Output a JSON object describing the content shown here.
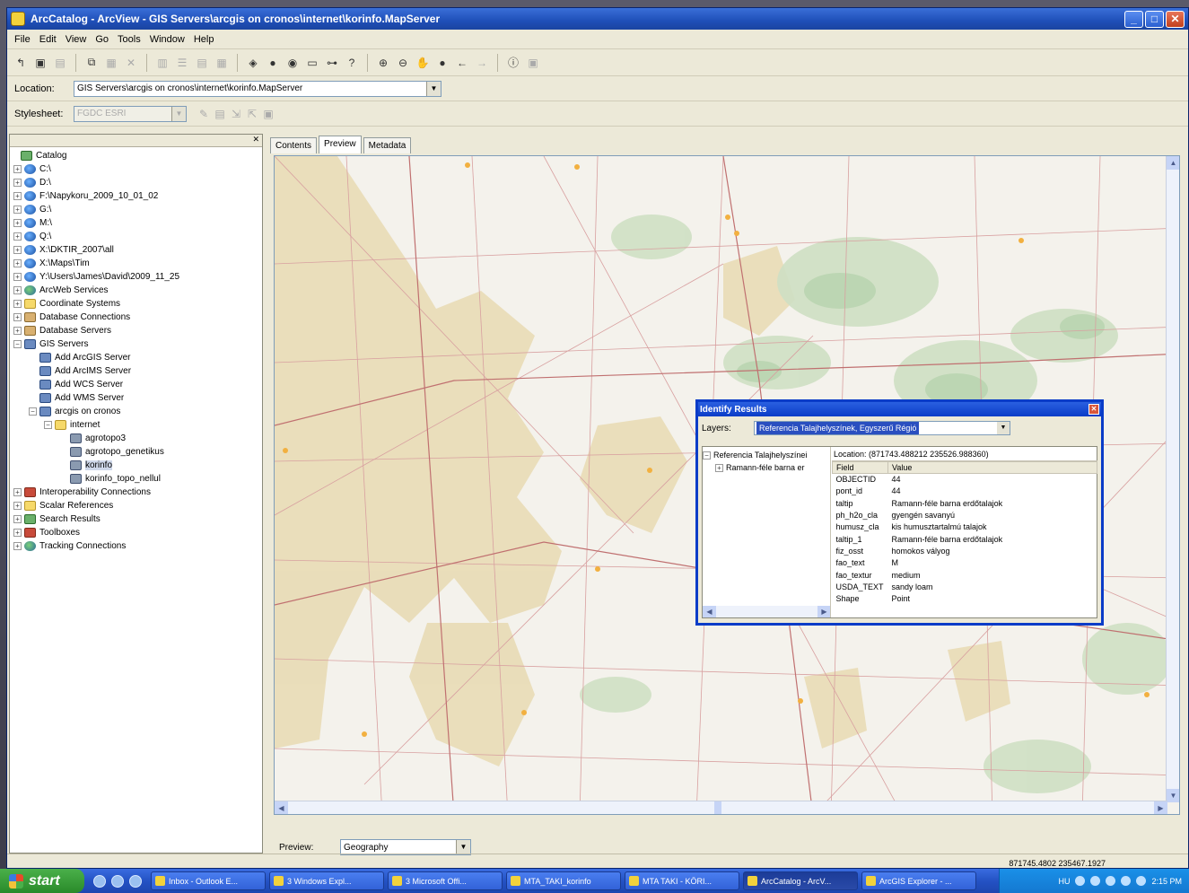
{
  "window": {
    "title": "ArcCatalog - ArcView - GIS Servers\\arcgis on cronos\\internet\\korinfo.MapServer",
    "min": "_",
    "max": "□",
    "close": "✕"
  },
  "menu": [
    "File",
    "Edit",
    "View",
    "Go",
    "Tools",
    "Window",
    "Help"
  ],
  "location": {
    "label": "Location:",
    "value": "GIS Servers\\arcgis on cronos\\internet\\korinfo.MapServer"
  },
  "stylesheet": {
    "label": "Stylesheet:",
    "value": "FGDC ESRI"
  },
  "catalog": {
    "root": "Catalog",
    "items": [
      {
        "label": "C:\\",
        "level": 1,
        "icon": "drive"
      },
      {
        "label": "D:\\",
        "level": 1,
        "icon": "drive"
      },
      {
        "label": "F:\\Napykoru_2009_10_01_02",
        "level": 1,
        "icon": "drive"
      },
      {
        "label": "G:\\",
        "level": 1,
        "icon": "drive"
      },
      {
        "label": "M:\\",
        "level": 1,
        "icon": "drive"
      },
      {
        "label": "Q:\\",
        "level": 1,
        "icon": "drive"
      },
      {
        "label": "X:\\DKTIR_2007\\all",
        "level": 1,
        "icon": "drive"
      },
      {
        "label": "X:\\Maps\\Tim",
        "level": 1,
        "icon": "drive"
      },
      {
        "label": "Y:\\Users\\James\\David\\2009_11_25",
        "level": 1,
        "icon": "drive"
      },
      {
        "label": "ArcWeb Services",
        "level": 1,
        "icon": "globe"
      },
      {
        "label": "Coordinate Systems",
        "level": 1,
        "icon": "folder"
      },
      {
        "label": "Database Connections",
        "level": 1,
        "icon": "db"
      },
      {
        "label": "Database Servers",
        "level": 1,
        "icon": "db"
      },
      {
        "label": "GIS Servers",
        "level": 1,
        "icon": "server"
      },
      {
        "label": "Add ArcGIS Server",
        "level": 2,
        "icon": "server"
      },
      {
        "label": "Add ArcIMS Server",
        "level": 2,
        "icon": "server"
      },
      {
        "label": "Add WCS Server",
        "level": 2,
        "icon": "server"
      },
      {
        "label": "Add WMS Server",
        "level": 2,
        "icon": "server"
      },
      {
        "label": "arcgis on cronos",
        "level": 2,
        "icon": "server"
      },
      {
        "label": "internet",
        "level": 3,
        "icon": "folder"
      },
      {
        "label": "agrotopo3",
        "level": 4,
        "icon": "layer"
      },
      {
        "label": "agrotopo_genetikus",
        "level": 4,
        "icon": "layer"
      },
      {
        "label": "korinfo",
        "level": 4,
        "icon": "layer"
      },
      {
        "label": "korinfo_topo_nellul",
        "level": 4,
        "icon": "layer"
      },
      {
        "label": "Interoperability Connections",
        "level": 1,
        "icon": "red"
      },
      {
        "label": "Scalar References",
        "level": 1,
        "icon": "folder"
      },
      {
        "label": "Search Results",
        "level": 1,
        "icon": "green"
      },
      {
        "label": "Toolboxes",
        "level": 1,
        "icon": "red"
      },
      {
        "label": "Tracking Connections",
        "level": 1,
        "icon": "globe"
      }
    ]
  },
  "tabs": [
    "Contents",
    "Preview",
    "Metadata"
  ],
  "preview": {
    "label": "Preview:",
    "value": "Geography"
  },
  "status": {
    "coords": "871745.4802  235467.1927"
  },
  "identify": {
    "title": "Identify Results",
    "layers_label": "Layers:",
    "layers_value": "Referencia Talajhelyszínek, Egyszerű Régió",
    "tree_root": "Referencia Talajhelyszínei",
    "tree_child": "Ramann-féle barna er",
    "location": "Location: (871743.488212  235526.988360)",
    "col_field": "Field",
    "col_value": "Value",
    "rows": [
      {
        "field": "OBJECTID",
        "value": "44"
      },
      {
        "field": "pont_id",
        "value": "44"
      },
      {
        "field": "taltip",
        "value": "Ramann-féle barna erdőtalajok"
      },
      {
        "field": "ph_h2o_cla",
        "value": "gyengén savanyú"
      },
      {
        "field": "humusz_cla",
        "value": "kis humusztartalmú talajok"
      },
      {
        "field": "taltip_1",
        "value": "Ramann-féle barna erdőtalajok"
      },
      {
        "field": "fiz_osst",
        "value": "homokos vályog"
      },
      {
        "field": "fao_text",
        "value": "M"
      },
      {
        "field": "fao_textur",
        "value": "medium"
      },
      {
        "field": "USDA_TEXT",
        "value": "sandy loam"
      },
      {
        "field": "Shape",
        "value": "Point"
      }
    ]
  },
  "taskbar": {
    "start": "start",
    "tasks": [
      "Inbox - Outlook E...",
      "3 Windows Expl...",
      "3 Microsoft Offi...",
      "MTA_TAKI_korinfo",
      "MTA TAKI - KÖRI...",
      "ArcCatalog - ArcV...",
      "ArcGIS Explorer - ..."
    ],
    "lang": "HU",
    "clock": "2:15 PM"
  }
}
